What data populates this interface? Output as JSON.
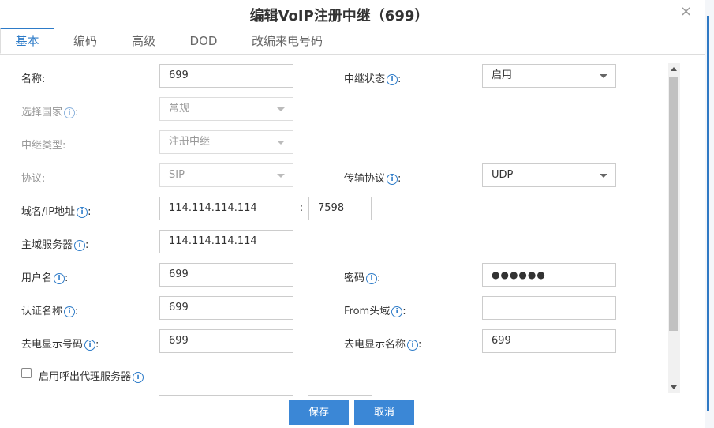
{
  "dialog": {
    "title": "编辑VoIP注册中继（699）",
    "close_glyph": "×"
  },
  "tabs": [
    "基本",
    "编码",
    "高级",
    "DOD",
    "改编来电号码"
  ],
  "form": {
    "name_label": "名称:",
    "name_value": "699",
    "trunk_status_label": "中继状态",
    "trunk_status_value": "启用",
    "country_label": "选择国家",
    "country_value": "常规",
    "trunk_type_label": "中继类型:",
    "trunk_type_value": "注册中继",
    "protocol_label": "协议:",
    "protocol_value": "SIP",
    "transport_label": "传输协议",
    "transport_value": "UDP",
    "domain_label": "域名/IP地址",
    "domain_value": "114.114.114.114",
    "port_value": "7598",
    "port_sep": ":",
    "primary_server_label": "主域服务器",
    "primary_server_value": "114.114.114.114",
    "username_label": "用户名",
    "username_value": "699",
    "password_label": "密码",
    "password_value": "●●●●●●",
    "auth_name_label": "认证名称",
    "auth_name_value": "699",
    "from_domain_label": "From头域",
    "from_domain_value": "",
    "callerid_number_label": "去电显示号码",
    "callerid_number_value": "699",
    "callerid_name_label": "去电显示名称",
    "callerid_name_value": "699",
    "outbound_proxy_label": "启用呼出代理服务器"
  },
  "buttons": {
    "save": "保存",
    "cancel": "取消"
  },
  "colors": {
    "accent": "#2d7bc8",
    "button": "#3b87d6"
  }
}
